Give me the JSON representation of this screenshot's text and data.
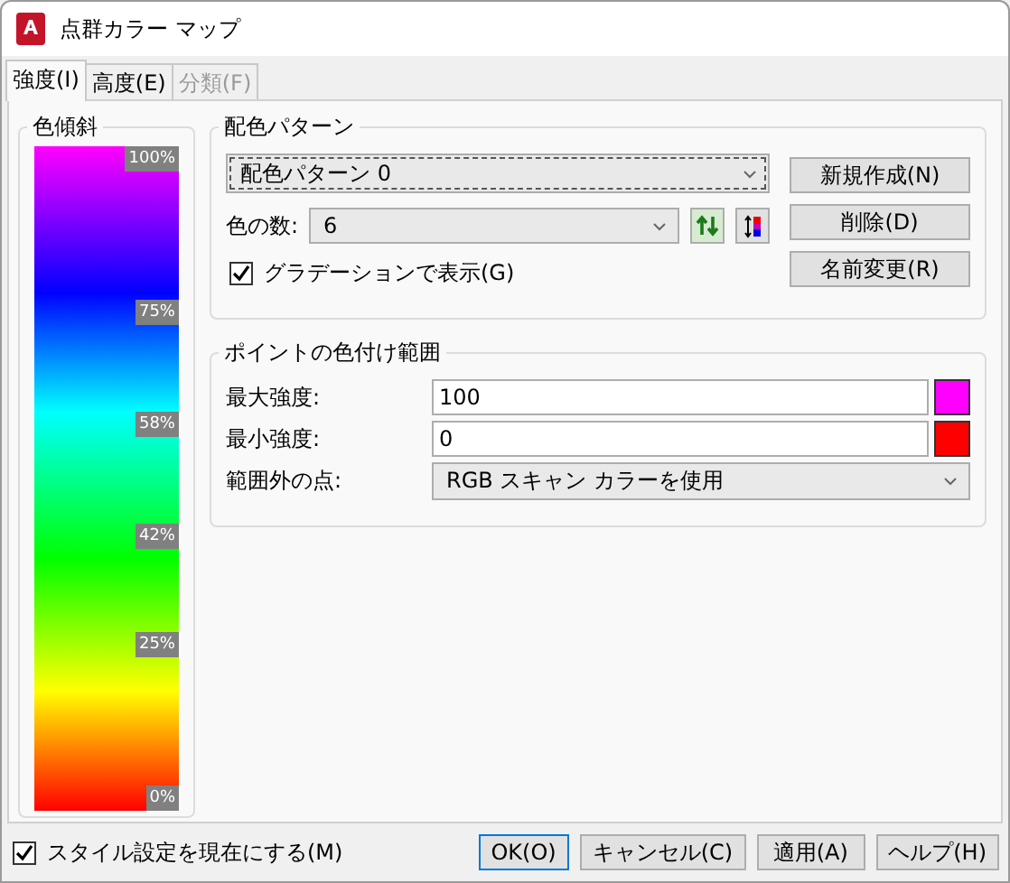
{
  "window": {
    "title": "点群カラー マップ"
  },
  "tabs": [
    {
      "label": "強度(I)",
      "selected": true,
      "disabled": false
    },
    {
      "label": "高度(E)",
      "selected": false,
      "disabled": false
    },
    {
      "label": "分類(F)",
      "selected": false,
      "disabled": true
    }
  ],
  "ramp": {
    "title": "色傾斜",
    "ticks": [
      {
        "label": "100%",
        "level": 1
      },
      {
        "label": "75%",
        "level": 0.76
      },
      {
        "label": "58%",
        "level": 0.585
      },
      {
        "label": "42%",
        "level": 0.41
      },
      {
        "label": "25%",
        "level": 0.24
      },
      {
        "label": "0%",
        "level": 0
      }
    ]
  },
  "scheme": {
    "title": "配色パターン",
    "pattern": "配色パターン 0",
    "count_label": "色の数:",
    "count": "6",
    "gradient": {
      "label": "グラデーションで表示(G)",
      "checked": true
    },
    "buttons": [
      "新規作成(N)",
      "削除(D)",
      "名前変更(R)"
    ]
  },
  "range": {
    "title": "ポイントの色付け範囲",
    "rows": [
      {
        "kind": "input",
        "label": "最大強度:",
        "value": "100",
        "color": "#ff00ff"
      },
      {
        "kind": "input",
        "label": "最小強度:",
        "value": "0",
        "color": "#ff0000"
      },
      {
        "kind": "select",
        "label": "範囲外の点:",
        "value": "RGB スキャン カラーを使用"
      }
    ]
  },
  "footer": {
    "current_style": {
      "label": "スタイル設定を現在にする(M)",
      "checked": true
    },
    "buttons": [
      {
        "label": "OK(O)",
        "default": true
      },
      {
        "label": "キャンセル(C)",
        "default": false
      },
      {
        "label": "適用(A)",
        "default": false
      },
      {
        "label": "ヘルプ(H)",
        "default": false
      }
    ]
  }
}
